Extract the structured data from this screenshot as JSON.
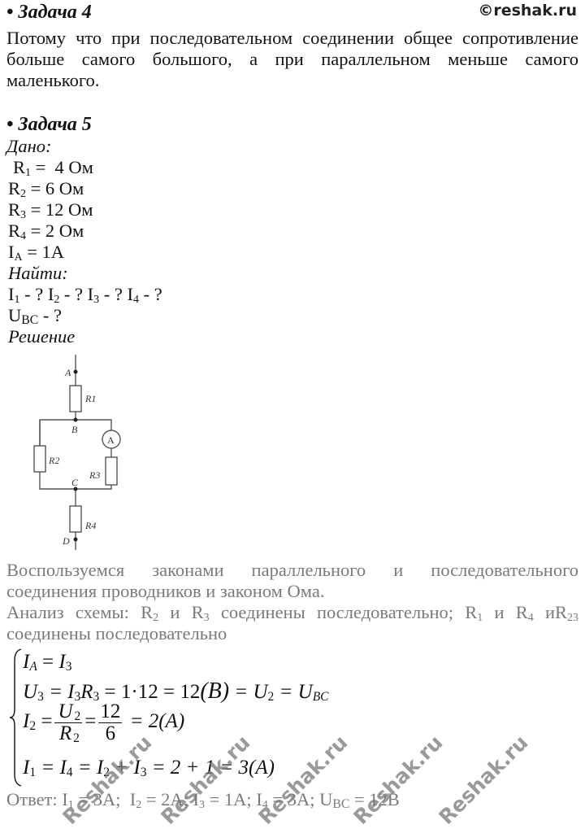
{
  "site": {
    "copyright": "©reshak.ru"
  },
  "task4": {
    "heading": "• Задача 4",
    "line1": "Потому что при последовательном соединении общее сопротивление",
    "line2": "больше самого большого, а при параллельном меньше самого",
    "line3": "маленького."
  },
  "task5": {
    "heading": "• Задача 5",
    "given_label": "Дано:",
    "given": [
      {
        "sym": "R",
        "sub": "1",
        "rest": " =  4 Ом"
      },
      {
        "sym": "R",
        "sub": "2",
        "rest": " = 6 Ом"
      },
      {
        "sym": "R",
        "sub": "3",
        "rest": " = 12 Ом"
      },
      {
        "sym": "R",
        "sub": "4",
        "rest": " = 2 Ом"
      },
      {
        "sym": "I",
        "sub": "A",
        "rest": " = 1A"
      }
    ],
    "find_label": "Найти:",
    "find": {
      "i1": "I",
      "i1s": "1",
      "q": " - ? ",
      "i2": "I",
      "i2s": "2",
      "i3": "I",
      "i3s": "3",
      "i4": "I",
      "i4s": "4",
      "q_end": " - ?",
      "u": "U",
      "us": "BC",
      "u_q": " - ?"
    },
    "solution_label": "Решение",
    "circuit": {
      "nodes": [
        "A",
        "B",
        "C",
        "D"
      ],
      "resistors": [
        "R1",
        "R2",
        "R3",
        "R4"
      ],
      "ammeter": "A"
    },
    "explain": {
      "line1_words": [
        "Воспользуемся",
        "законами",
        "параллельного",
        "и",
        "последовательного"
      ],
      "line2": "соединения проводников и законом Ома.",
      "line3_a": "Анализ схемы: R",
      "line3_s2": "2",
      "line3_b": " и R",
      "line3_s3": "3",
      "line3_c": " соединены последовательно; R",
      "line3_s1": "1",
      "line3_d": " и R",
      "line3_s4": "4",
      "line3_e": " иR",
      "line3_s23": "23",
      "line4": "соединены последовательно"
    },
    "equations": {
      "eq1": {
        "lhs": "I",
        "lhs_s": "A",
        "eq": " = ",
        "rhs": "I",
        "rhs_s": "3"
      },
      "eq2": {
        "a": "U",
        "a_s": "3",
        "b": " = I",
        "b_s": "3",
        "c": "R",
        "c_s": "3",
        "d": " = 1·12 = 12",
        "e": "(B)",
        "f": " = U",
        "f_s": "2",
        "g": " = U",
        "g_s": "BC"
      },
      "eq3": {
        "a": "I",
        "a_s": "2",
        "num": "U",
        "num_s": "2",
        "den": "R",
        "den_s": "2",
        "num2": "12",
        "den2": "6",
        "res": " = 2(A)"
      },
      "eq4": {
        "a": "I",
        "a_s": "1",
        "b": " = I",
        "b_s": "4",
        "c": " = I",
        "c_s": "2",
        "d": " + I",
        "d_s": "3",
        "e": " = 2 + 1 = 3(A)"
      }
    },
    "answer": {
      "prefix": "Ответ: ",
      "i1": "I",
      "i1s": "1",
      "v1": " = 3A;  ",
      "i2": "I",
      "i2s": "2",
      "v2": " = 2A; ",
      "i3": "I",
      "i3s": "3",
      "v3": " = 1A; ",
      "i4": "I",
      "i4s": "4",
      "v4": " = 3A; ",
      "u": "U",
      "us": "BC",
      "vu": " = 12B"
    }
  },
  "watermarks": [
    "Reshak.ru",
    "Reshak.ru",
    "Reshak.ru",
    "Reshak.ru",
    "Reshak.ru"
  ]
}
